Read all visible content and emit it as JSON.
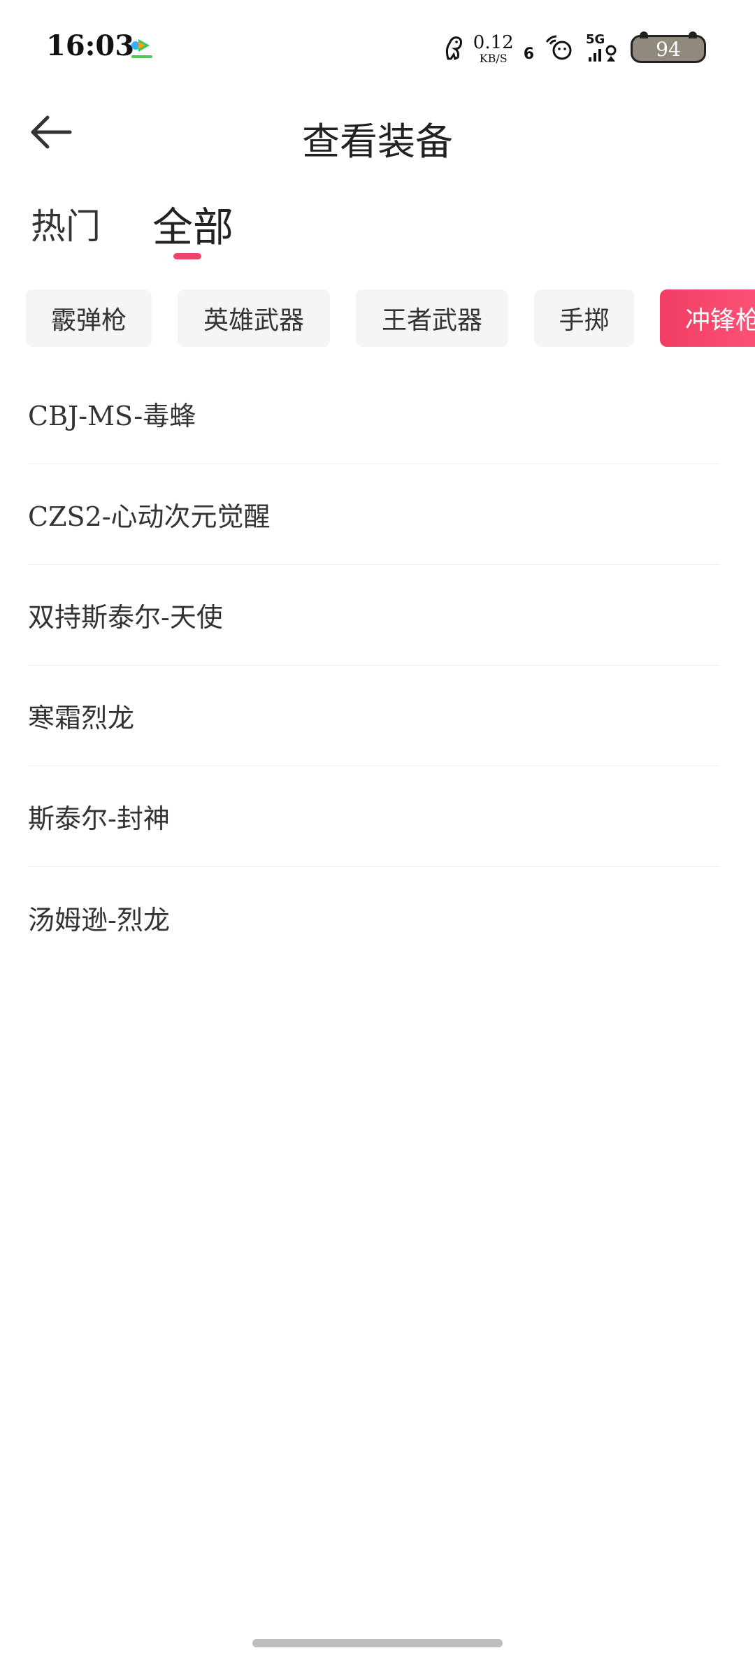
{
  "status_bar": {
    "time": "16:03",
    "net_speed_value": "0.12",
    "net_speed_unit": "KB/S",
    "signal_number": "6",
    "network_type": "5G",
    "battery_level": "94",
    "icons": [
      "video-app-icon",
      "dinosaur-icon",
      "hd-voice-icon",
      "wifi-icon",
      "signal-icon",
      "battery-icon"
    ]
  },
  "header": {
    "title": "查看装备",
    "back_icon": "arrow-left-icon"
  },
  "tabs": {
    "items": [
      {
        "label": "热门",
        "active": false
      },
      {
        "label": "全部",
        "active": true
      }
    ],
    "accent_color": "#f0446a"
  },
  "filters": {
    "items": [
      {
        "label": "霰弹枪",
        "active": false
      },
      {
        "label": "英雄武器",
        "active": false
      },
      {
        "label": "王者武器",
        "active": false
      },
      {
        "label": "手掷",
        "active": false
      },
      {
        "label": "冲锋枪",
        "active": true
      }
    ]
  },
  "equipment_list": {
    "items": [
      {
        "name": "CBJ-MS-毒蜂"
      },
      {
        "name": "CZS2-心动次元觉醒"
      },
      {
        "name": "双持斯泰尔-天使"
      },
      {
        "name": "寒霜烈龙"
      },
      {
        "name": "斯泰尔-封神"
      },
      {
        "name": "汤姆逊-烈龙"
      }
    ]
  }
}
